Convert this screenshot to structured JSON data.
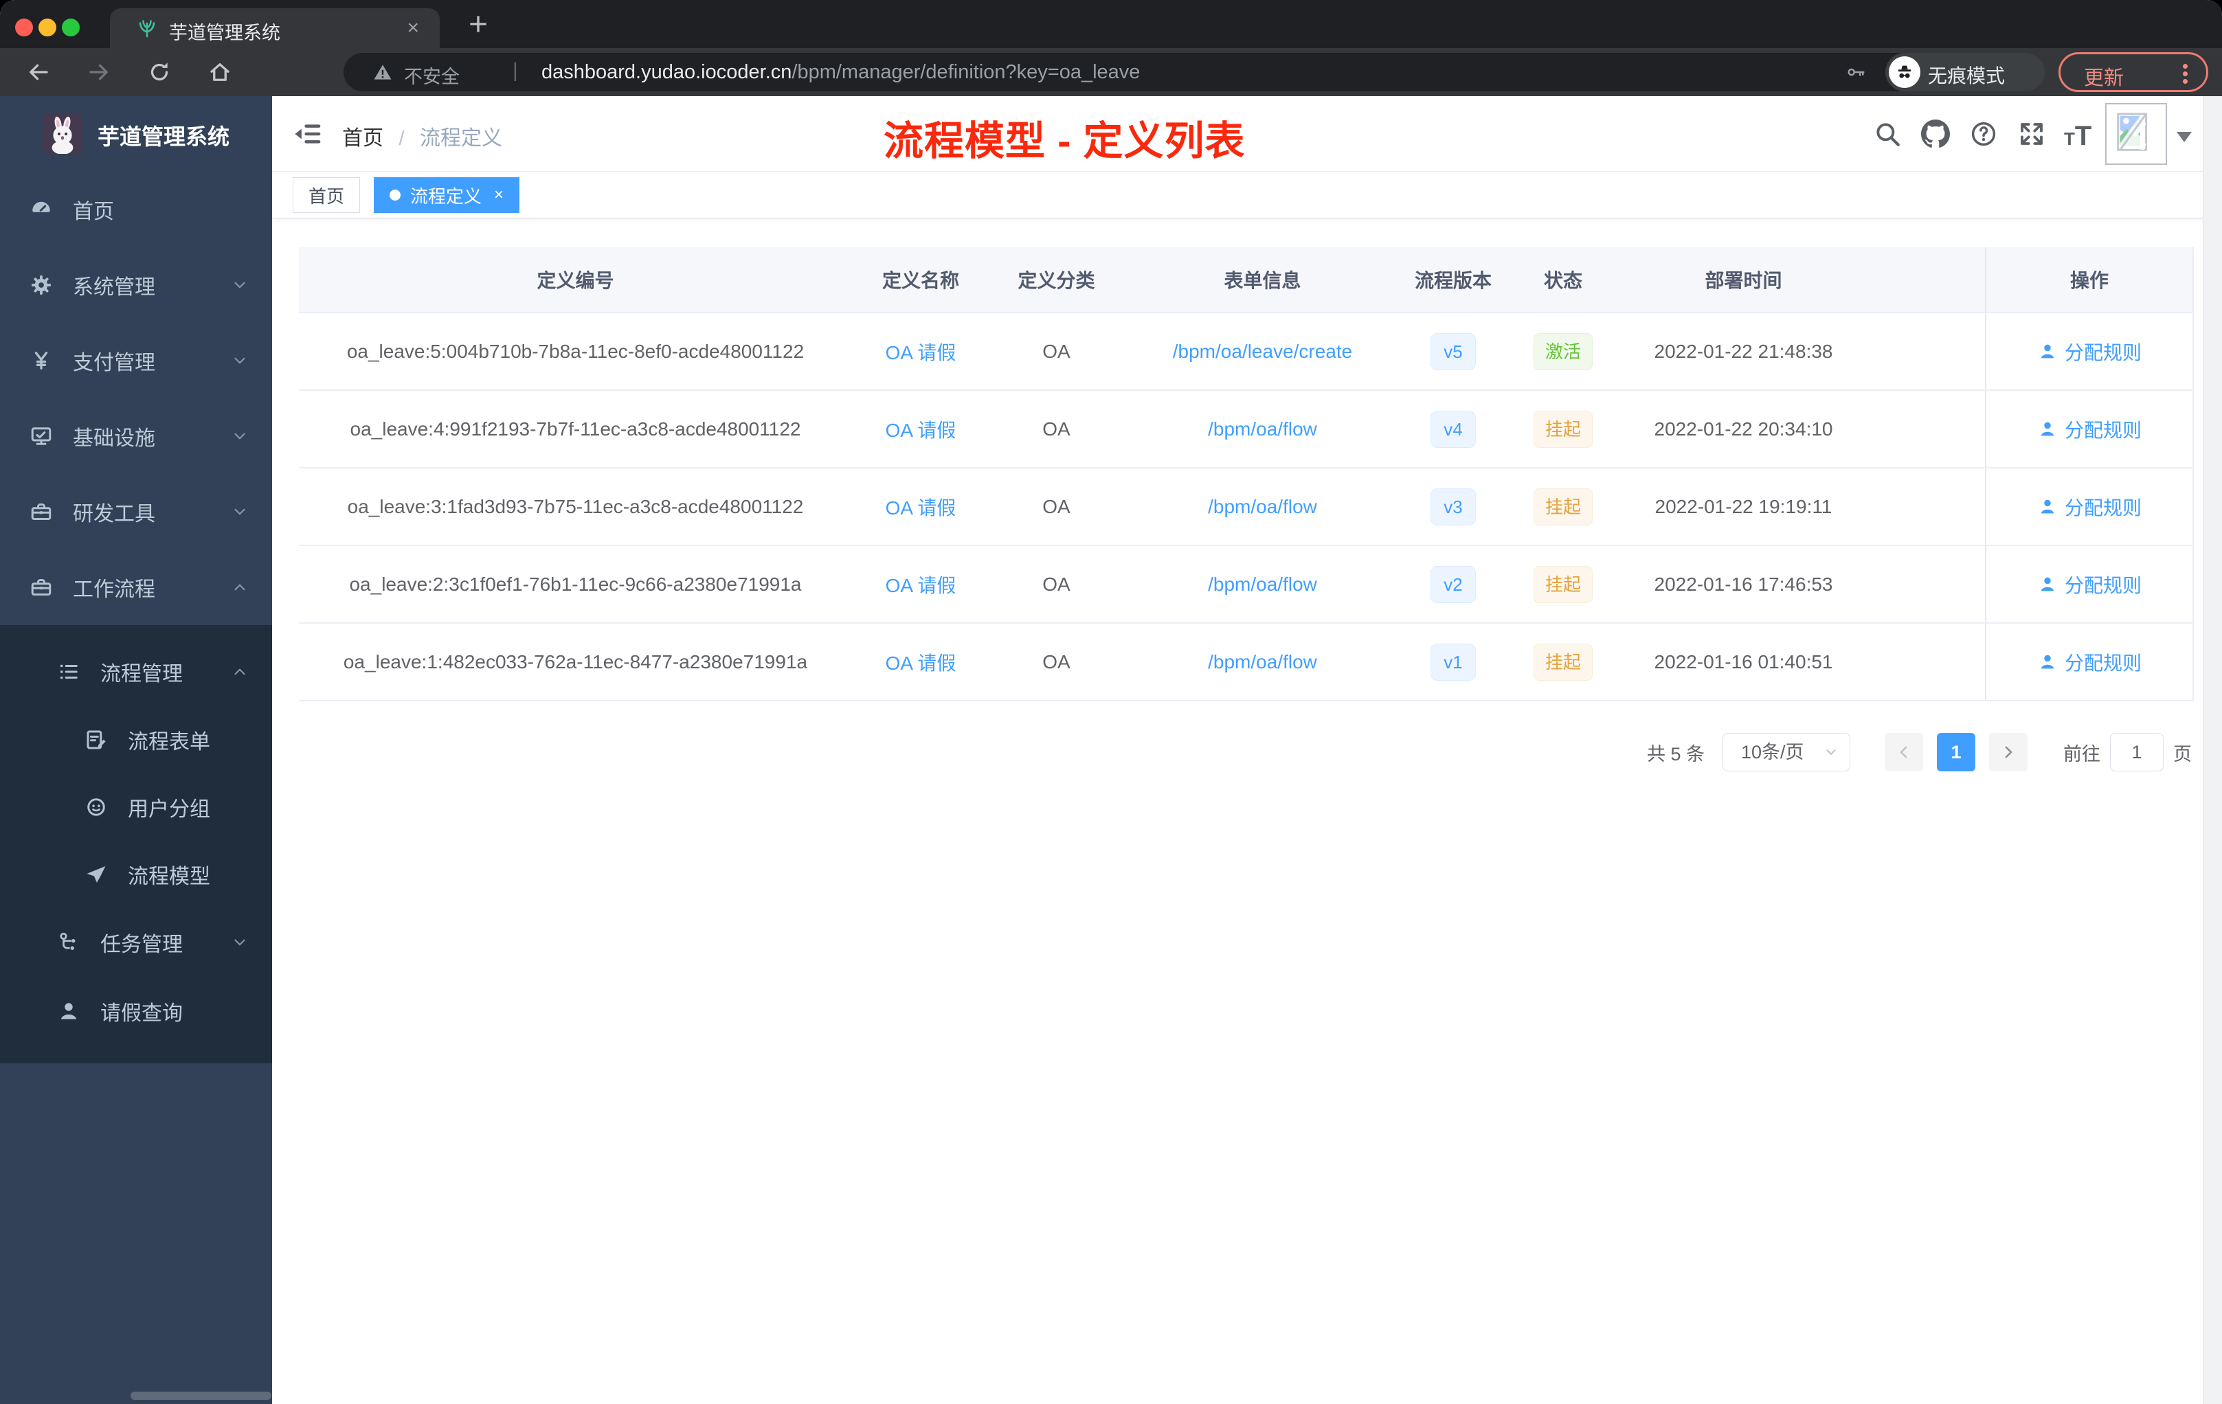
{
  "browser": {
    "tab_title": "芋道管理系统",
    "close_tab": "×",
    "security_label": "不安全",
    "url_separator": "|",
    "url_domain": "dashboard.yudao.iocoder.cn",
    "url_path": "/bpm/manager/definition?key=oa_leave",
    "incognito_label": "无痕模式",
    "update_label": "更新"
  },
  "sidebar": {
    "app_title": "芋道管理系统",
    "items": [
      {
        "label": "首页",
        "icon": "dashboard-icon"
      },
      {
        "label": "系统管理",
        "icon": "gear-icon"
      },
      {
        "label": "支付管理",
        "icon": "yen-icon"
      },
      {
        "label": "基础设施",
        "icon": "monitor-icon"
      },
      {
        "label": "研发工具",
        "icon": "toolbox-icon"
      },
      {
        "label": "工作流程",
        "icon": "toolbox-icon"
      },
      {
        "label": "流程管理",
        "icon": "tree-list-icon"
      },
      {
        "label": "流程表单",
        "icon": "form-icon"
      },
      {
        "label": "用户分组",
        "icon": "user-group-icon"
      },
      {
        "label": "流程模型",
        "icon": "paper-plane-icon"
      },
      {
        "label": "任务管理",
        "icon": "branch-icon"
      },
      {
        "label": "请假查询",
        "icon": "person-icon"
      }
    ]
  },
  "header": {
    "breadcrumb_home": "首页",
    "breadcrumb_sep": "/",
    "breadcrumb_current": "流程定义",
    "annotation": "流程模型 - 定义列表"
  },
  "tags": {
    "home": "首页",
    "active": "流程定义",
    "close": "×"
  },
  "table": {
    "columns": [
      "定义编号",
      "定义名称",
      "定义分类",
      "表单信息",
      "流程版本",
      "状态",
      "部署时间",
      "操作"
    ],
    "action_label": "分配规则",
    "rows": [
      {
        "id": "oa_leave:5:004b710b-7b8a-11ec-8ef0-acde48001122",
        "name": "OA 请假",
        "category": "OA",
        "form": "/bpm/oa/leave/create",
        "version": "v5",
        "status": "激活",
        "status_type": "active",
        "deployed_at": "2022-01-22 21:48:38"
      },
      {
        "id": "oa_leave:4:991f2193-7b7f-11ec-a3c8-acde48001122",
        "name": "OA 请假",
        "category": "OA",
        "form": "/bpm/oa/flow",
        "version": "v4",
        "status": "挂起",
        "status_type": "suspended",
        "deployed_at": "2022-01-22 20:34:10"
      },
      {
        "id": "oa_leave:3:1fad3d93-7b75-11ec-a3c8-acde48001122",
        "name": "OA 请假",
        "category": "OA",
        "form": "/bpm/oa/flow",
        "version": "v3",
        "status": "挂起",
        "status_type": "suspended",
        "deployed_at": "2022-01-22 19:19:11"
      },
      {
        "id": "oa_leave:2:3c1f0ef1-76b1-11ec-9c66-a2380e71991a",
        "name": "OA 请假",
        "category": "OA",
        "form": "/bpm/oa/flow",
        "version": "v2",
        "status": "挂起",
        "status_type": "suspended",
        "deployed_at": "2022-01-16 17:46:53"
      },
      {
        "id": "oa_leave:1:482ec033-762a-11ec-8477-a2380e71991a",
        "name": "OA 请假",
        "category": "OA",
        "form": "/bpm/oa/flow",
        "version": "v1",
        "status": "挂起",
        "status_type": "suspended",
        "deployed_at": "2022-01-16 01:40:51"
      }
    ]
  },
  "pagination": {
    "total": "共 5 条",
    "page_size": "10条/页",
    "page": "1",
    "goto_label": "前往",
    "goto_value": "1",
    "page_unit": "页"
  },
  "colors": {
    "accent": "#409eff",
    "status_active": "#67c23a",
    "status_suspended": "#e6a23c",
    "annotation_red": "#f9290e",
    "sidebar_bg": "#324157",
    "submenu_bg": "#1f2d3d"
  }
}
